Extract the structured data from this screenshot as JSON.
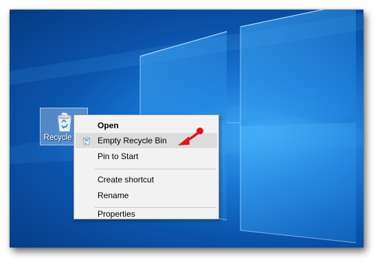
{
  "desktop": {
    "icon_label": "Recycle Bin",
    "icon_name": "recycle-bin-icon"
  },
  "context_menu": {
    "items": [
      {
        "label": "Open",
        "bold": true
      },
      {
        "label": "Empty Recycle Bin",
        "highlighted": true,
        "icon": "recycle-icon"
      },
      {
        "label": "Pin to Start"
      },
      {
        "label": "Create shortcut"
      },
      {
        "label": "Rename"
      },
      {
        "label": "Properties"
      }
    ]
  },
  "colors": {
    "wallpaper": "#0a54ac",
    "menu_background": "#f2f2f2",
    "menu_highlight": "#dcdcdc",
    "annotation_arrow": "#e0141e"
  },
  "annotation": {
    "type": "arrow",
    "points_to": "Empty Recycle Bin"
  }
}
